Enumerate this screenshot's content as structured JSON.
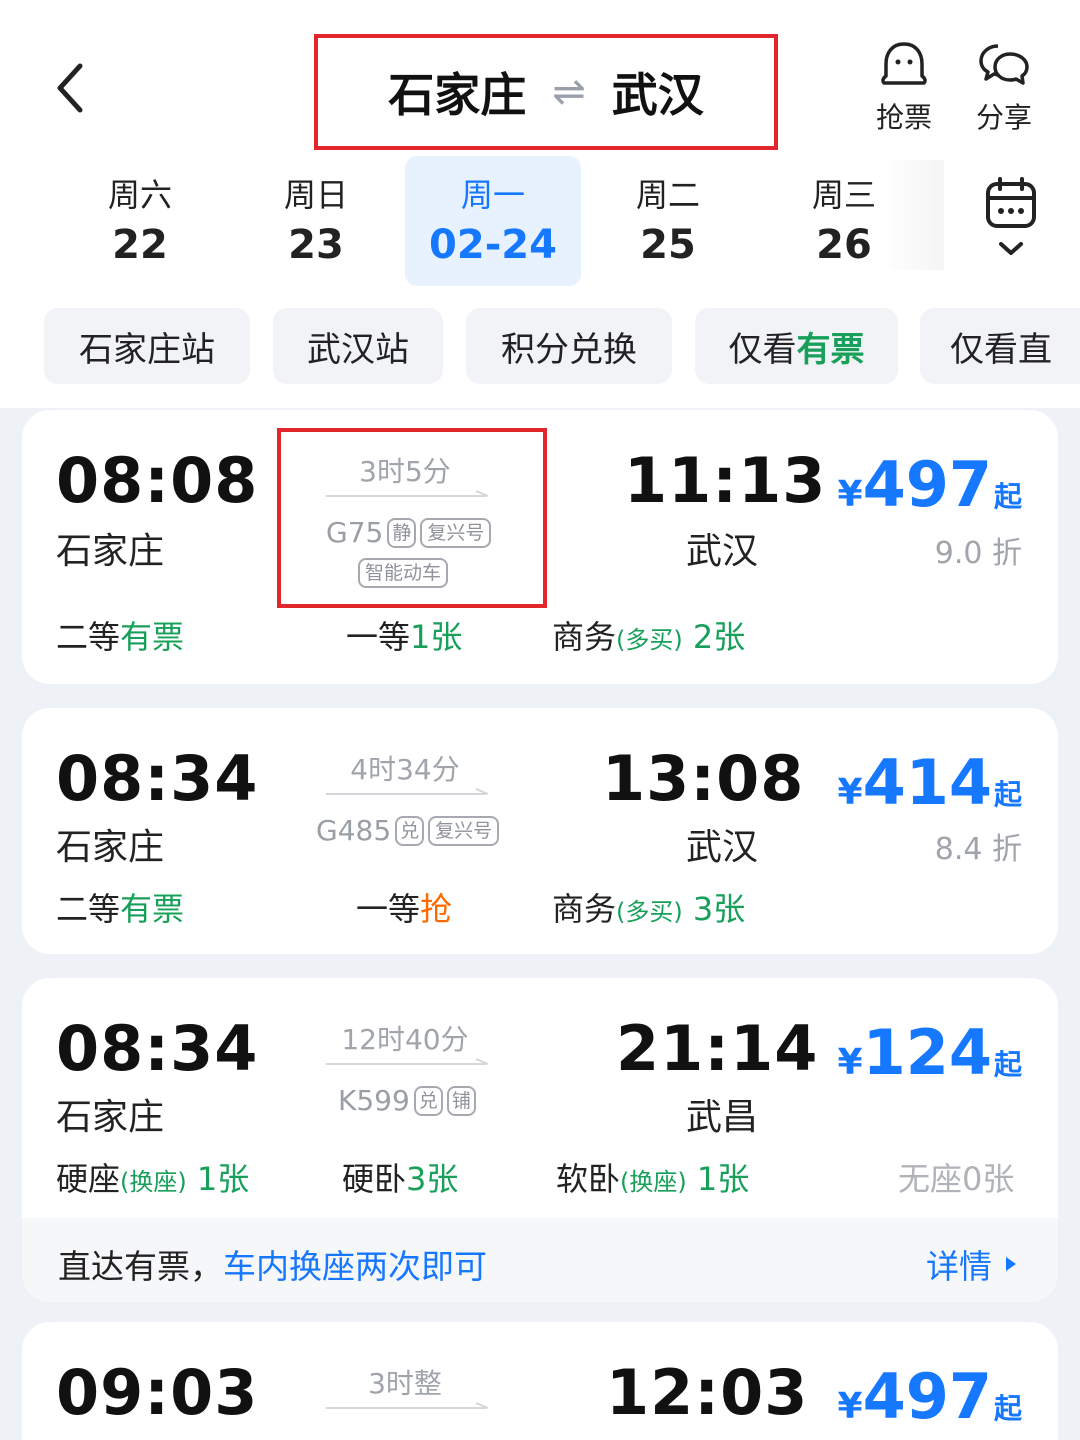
{
  "header": {
    "from": "石家庄",
    "swap_icon": "⇌",
    "to": "武汉",
    "grab_label": "抢票",
    "share_label": "分享"
  },
  "dates": [
    {
      "weekday": "周六",
      "day": "22"
    },
    {
      "weekday": "周日",
      "day": "23"
    },
    {
      "weekday": "周一",
      "day": "02-24",
      "selected": true
    },
    {
      "weekday": "周二",
      "day": "25"
    },
    {
      "weekday": "周三",
      "day": "26"
    }
  ],
  "filters": {
    "f1": "石家庄站",
    "f2": "武汉站",
    "f3": "积分兑换",
    "f4_prefix": "仅看",
    "f4_em": "有票",
    "f5": "仅看直"
  },
  "trains": [
    {
      "depart": "08:08",
      "from": "石家庄",
      "duration": "3时5分",
      "number": "G75",
      "tags": [
        "静",
        "复兴号"
      ],
      "tag2": "智能动车",
      "arrive": "11:13",
      "to": "武汉",
      "price_symbol": "¥",
      "price": "497",
      "price_suffix": "起",
      "discount": "9.0 折",
      "seat1_name": "二等",
      "seat1_status": "有票",
      "seat2_name": "一等",
      "seat2_status": "1张",
      "seat3_name": "商务",
      "seat3_note": "(多买)",
      "seat3_status": "2张"
    },
    {
      "depart": "08:34",
      "from": "石家庄",
      "duration": "4时34分",
      "number": "G485",
      "tags": [
        "兑",
        "复兴号"
      ],
      "arrive": "13:08",
      "to": "武汉",
      "price_symbol": "¥",
      "price": "414",
      "price_suffix": "起",
      "discount": "8.4 折",
      "seat1_name": "二等",
      "seat1_status": "有票",
      "seat2_name": "一等",
      "seat2_status": "抢",
      "seat3_name": "商务",
      "seat3_note": "(多买)",
      "seat3_status": "3张"
    },
    {
      "depart": "08:34",
      "from": "石家庄",
      "duration": "12时40分",
      "number": "K599",
      "tags": [
        "兑",
        "铺"
      ],
      "arrive": "21:14",
      "to": "武昌",
      "price_symbol": "¥",
      "price": "124",
      "price_suffix": "起",
      "seat1_name": "硬座",
      "seat1_note": "(换座)",
      "seat1_status": "1张",
      "seat2_name": "硬卧",
      "seat2_status": "3张",
      "seat3_name": "软卧",
      "seat3_note": "(换座)",
      "seat3_status": "1张",
      "seat4_name": "无座",
      "seat4_status": "0张",
      "notice_prefix": "直达有票，",
      "notice_link": "车内换座两次即可",
      "notice_detail": "详情"
    },
    {
      "depart": "09:03",
      "duration": "3时整",
      "arrive": "12:03",
      "price_symbol": "¥",
      "price": "497",
      "price_suffix": "起"
    }
  ]
}
